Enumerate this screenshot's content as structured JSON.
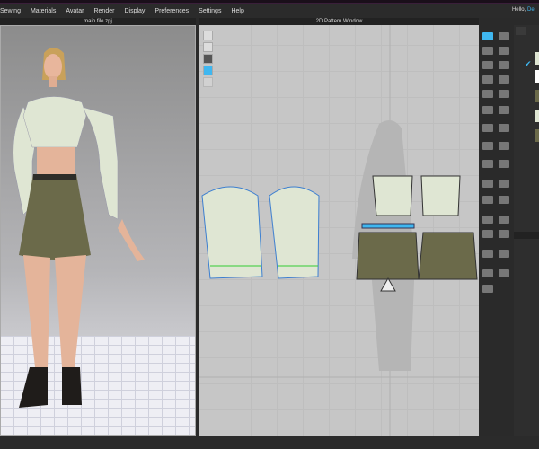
{
  "menu": [
    "Sewing",
    "Materials",
    "Avatar",
    "Render",
    "Display",
    "Preferences",
    "Settings",
    "Help"
  ],
  "greeting": "Hello,",
  "user": "Del",
  "panels": {
    "view3d_title": "main file.zpj",
    "view2d_title": "2D Pattern Window"
  },
  "colors": {
    "accent": "#3fb7f0",
    "fabric_print": "#dfe6d3",
    "skirt": "#6b6a4a"
  },
  "right_panel": {
    "checked_icon": "check-icon"
  }
}
